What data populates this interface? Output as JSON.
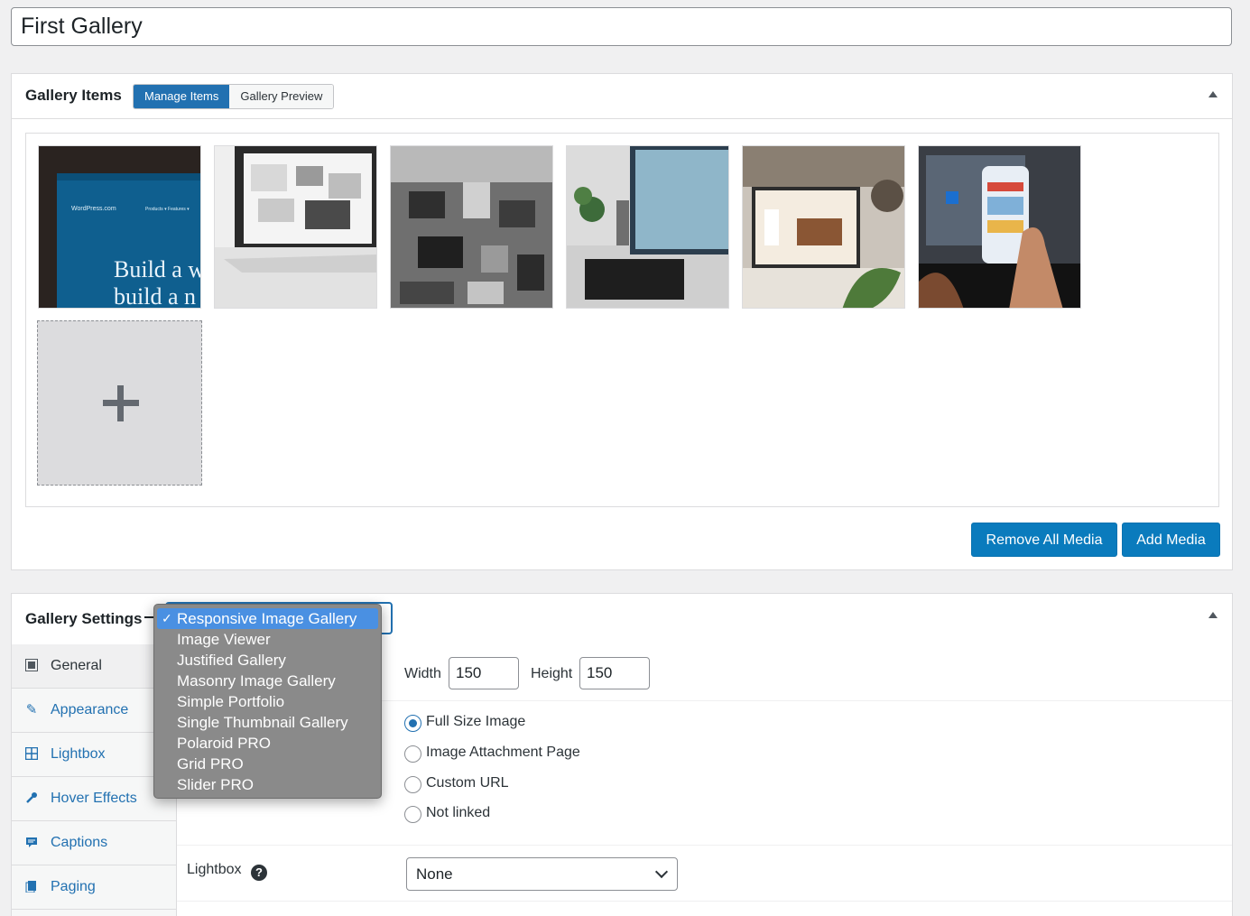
{
  "gallery_title": "First Gallery",
  "items_box": {
    "title": "Gallery Items",
    "tabs": [
      "Manage Items",
      "Gallery Preview"
    ],
    "thumb_wp": {
      "brand": "WordPress.com",
      "menu": "Products ▾   Features ▾",
      "line1": "Build a w",
      "line2": "build a n"
    },
    "remove_all_label": "Remove All Media",
    "add_media_label": "Add Media"
  },
  "settings_box": {
    "title": "Gallery Settings",
    "gallery_types": [
      "Responsive Image Gallery",
      "Image Viewer",
      "Justified Gallery",
      "Masonry Image Gallery",
      "Simple Portfolio",
      "Single Thumbnail Gallery",
      "Polaroid PRO",
      "Grid PRO",
      "Slider PRO"
    ],
    "sidebar": [
      {
        "label": "General",
        "icon": "image-icon"
      },
      {
        "label": "Appearance",
        "icon": "brush-icon"
      },
      {
        "label": "Lightbox",
        "icon": "grid-icon"
      },
      {
        "label": "Hover Effects",
        "icon": "wrench-icon"
      },
      {
        "label": "Captions",
        "icon": "caption-icon"
      },
      {
        "label": "Paging",
        "icon": "pages-icon"
      }
    ],
    "width_label": "Width",
    "width_value": "150",
    "height_label": "Height",
    "height_value": "150",
    "link_options": [
      "Full Size Image",
      "Image Attachment Page",
      "Custom URL",
      "Not linked"
    ],
    "lightbox_label": "Lightbox",
    "lightbox_value": "None"
  },
  "colors": {
    "primary_button": "#0a7bbd",
    "accent": "#2271b1",
    "dropdown_bg": "#8a8a8a",
    "dropdown_selected": "#4a90e2"
  }
}
